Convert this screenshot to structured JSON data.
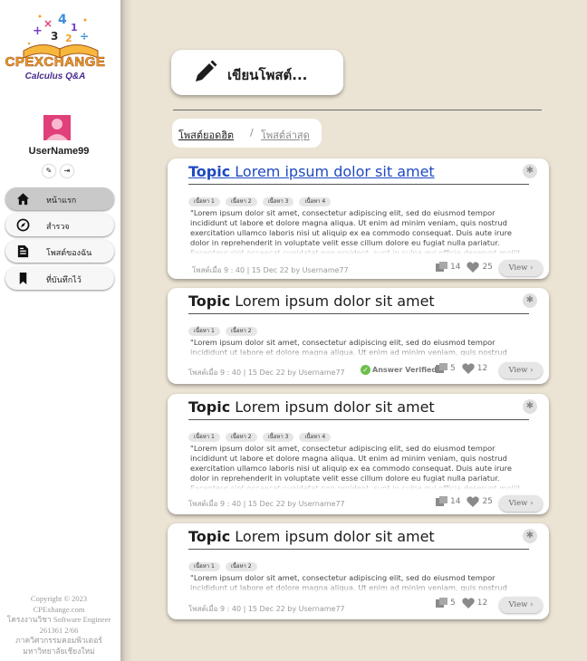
{
  "brand": {
    "title": "CPEXCHANGE",
    "subtitle": "Calculus Q&A"
  },
  "user": {
    "name": "UserName99"
  },
  "sidebar": {
    "items": [
      {
        "label": "หน้าแรก",
        "icon": "home-icon",
        "active": true
      },
      {
        "label": "สำรวจ",
        "icon": "compass-icon",
        "active": false
      },
      {
        "label": "โพสต์ของฉัน",
        "icon": "my-posts-icon",
        "active": false
      },
      {
        "label": "ที่บันทึกไว้",
        "icon": "bookmark-icon",
        "active": false
      }
    ],
    "copyright": [
      "Copyright © 2023",
      "CPExhange.com",
      "โครงงานวิชา Software Engineer",
      "261361 2/66",
      "ภาควิศวกรรมคอมพิวเตอร์",
      "มหาวิทยาลัยเชียงใหม่"
    ]
  },
  "write_post": {
    "label": "เขียนโพสต์..."
  },
  "filters": {
    "popular": "โพสต์ยอดฮิต",
    "separator": "/",
    "latest": "โพสต์ล่าสุด"
  },
  "posts": [
    {
      "topic_word": "Topic",
      "title": "Lorem ipsum dolor sit amet",
      "tags": [
        "เนื้อหา 1",
        "เนื้อหา 2",
        "เนื้อหา 3",
        "เนื้อหา 4"
      ],
      "excerpt": "\"Lorem ipsum dolor sit amet, consectetur adipiscing elit, sed do eiusmod tempor incididunt ut labore et dolore magna aliqua. Ut enim ad minim veniam, quis nostrud exercitation ullamco laboris nisi ut aliquip ex ea commodo consequat. Duis aute irure dolor in reprehenderit in voluptate velit esse cillum dolore eu fugiat nulla pariatur. Excepteur sint occaecat cupidatat non proident, sunt in culpa qui officia deserunt mollit anim id est laborum.\"",
      "meta": "โพสต์เมื่อ 9 : 40 | 15 Dec 22 by Username77",
      "answer_verified": "",
      "comments": "14",
      "likes": "25",
      "view": "View ›"
    },
    {
      "topic_word": "Topic",
      "title": "Lorem ipsum dolor sit amet",
      "tags": [
        "เนื้อหา 1",
        "เนื้อหา 2"
      ],
      "excerpt": "\"Lorem ipsum dolor sit amet, consectetur adipiscing elit, sed do eiusmod tempor incididunt ut labore et dolore magna aliqua. Ut enim ad minim veniam, quis nostrud exercitation ullamco",
      "meta": "โพสต์เมื่อ 9 : 40 | 15 Dec 22 by Username77",
      "answer_verified": "Answer Verified",
      "comments": "5",
      "likes": "12",
      "view": "View ›"
    },
    {
      "topic_word": "Topic",
      "title": "Lorem ipsum dolor sit amet",
      "tags": [
        "เนื้อหา 1",
        "เนื้อหา 2",
        "เนื้อหา 3",
        "เนื้อหา 4"
      ],
      "excerpt": "\"Lorem ipsum dolor sit amet, consectetur adipiscing elit, sed do eiusmod tempor incididunt ut labore et dolore magna aliqua. Ut enim ad minim veniam, quis nostrud exercitation ullamco laboris nisi ut aliquip ex ea commodo consequat. Duis aute irure dolor in reprehenderit in voluptate velit esse cillum dolore eu fugiat nulla pariatur. Excepteur sint occaecat cupidatat non proident, sunt in culpa qui officia deserunt mollit anim id est laborum.\"",
      "meta": "โพสต์เมื่อ 9 : 40 | 15 Dec 22 by Username77",
      "answer_verified": "",
      "comments": "14",
      "likes": "25",
      "view": "View ›"
    },
    {
      "topic_word": "Topic",
      "title": "Lorem ipsum dolor sit amet",
      "tags": [
        "เนื้อหา 1",
        "เนื้อหา 2"
      ],
      "excerpt": "\"Lorem ipsum dolor sit amet, consectetur adipiscing elit, sed do eiusmod tempor incididunt ut labore et dolore magna aliqua. Ut enim ad minim veniam, quis nostrud exercitation ullamco",
      "meta": "โพสต์เมื่อ 9 : 40 | 15 Dec 22 by Username77",
      "answer_verified": "",
      "comments": "5",
      "likes": "12",
      "view": "View ›"
    }
  ],
  "colors": {
    "background": "#ebe3d3",
    "link": "#1f49c2",
    "verified": "#6cbf4a",
    "brand_orange": "#f4a127"
  }
}
